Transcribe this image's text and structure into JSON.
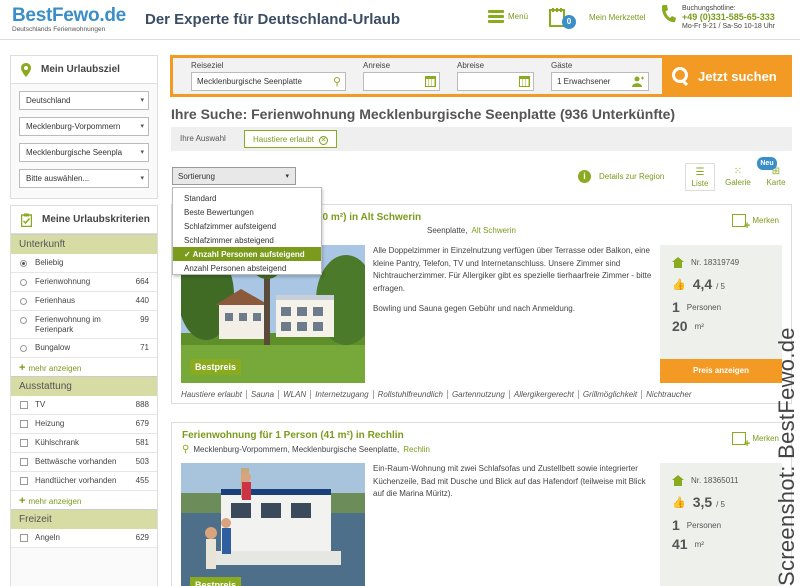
{
  "header": {
    "logo": "BestFewo.de",
    "logo_sub": "Deutschlands Ferienwohnungen",
    "tagline": "Der Experte für Deutschland-Urlaub",
    "menu_label": "Menü",
    "merkzettel_label": "Mein Merkzettel",
    "merkzettel_count": "0",
    "hotline_label": "Buchungshotline:",
    "hotline_number": "+49 (0)331-585-65-333",
    "hotline_hours": "Mo-Fr 9-21 / Sa-So 10-18 Uhr"
  },
  "sidebar": {
    "goal_title": "Mein Urlaubsziel",
    "selects": [
      "Deutschland",
      "Mecklenburg-Vorpommern",
      "Mecklenburgische Seenpla",
      "Bitte auswählen..."
    ],
    "criteria_title": "Meine Urlaubskriterien",
    "unterkunft": {
      "title": "Unterkunft",
      "items": [
        {
          "label": "Beliebig",
          "count": ""
        },
        {
          "label": "Ferienwohnung",
          "count": "664"
        },
        {
          "label": "Ferienhaus",
          "count": "440"
        },
        {
          "label": "Ferienwohnung im Ferienpark",
          "count": "99"
        },
        {
          "label": "Bungalow",
          "count": "71"
        }
      ],
      "more": "mehr anzeigen"
    },
    "ausstattung": {
      "title": "Ausstattung",
      "items": [
        {
          "label": "TV",
          "count": "888"
        },
        {
          "label": "Heizung",
          "count": "679"
        },
        {
          "label": "Kühlschrank",
          "count": "581"
        },
        {
          "label": "Bettwäsche vorhanden",
          "count": "503"
        },
        {
          "label": "Handtücher vorhanden",
          "count": "455"
        }
      ],
      "more": "mehr anzeigen"
    },
    "freizeit": {
      "title": "Freizeit",
      "items": [
        {
          "label": "Angeln",
          "count": "629"
        }
      ]
    }
  },
  "search": {
    "reiseziel_label": "Reiseziel",
    "reiseziel_value": "Mecklenburgische Seenplatte",
    "anreise_label": "Anreise",
    "abreise_label": "Abreise",
    "gaeste_label": "Gäste",
    "gaeste_value": "1 Erwachsener",
    "button": "Jetzt suchen"
  },
  "results": {
    "title": "Ihre Suche: Ferienwohnung Mecklenburgische Seenplatte (936 Unterkünfte)",
    "selection_label": "Ihre Auswahl",
    "selection_tag": "Haustiere erlaubt",
    "sort_label": "Sortierung",
    "details_region": "Details zur Region",
    "views": {
      "list": "Liste",
      "gallery": "Galerie",
      "map": "Karte",
      "new_badge": "Neu"
    },
    "sort_options": [
      "Standard",
      "Beste Bewertungen",
      "Schlafzimmer aufsteigend",
      "Schlafzimmer absteigend",
      "Anzahl Personen aufsteigend",
      "Anzahl Personen absteigend"
    ]
  },
  "listings": [
    {
      "title": "20 m²) in Alt Schwerin",
      "location": "Seenplatte,",
      "location_link": "Alt Schwerin",
      "merken": "Merken",
      "badge": "Bestpreis",
      "description": "Alle Doppelzimmer in Einzelnutzung verfügen über Terrasse oder Balkon, eine kleine Pantry, Telefon, TV und Internetanschluss. Unsere Zimmer sind Nichtraucherzimmer. Für Allergiker gibt es spezielle tierhaarfreie Zimmer - bitte erfragen.",
      "description2": "Bowling und Sauna gegen Gebühr und nach Anmeldung.",
      "nr": "Nr. 18319749",
      "rating": "4,4",
      "rating_max": "/ 5",
      "persons": "1",
      "persons_label": "Personen",
      "size": "20",
      "size_unit": "m²",
      "price_button": "Preis anzeigen",
      "features": [
        "Haustiere erlaubt",
        "Sauna",
        "WLAN",
        "Internetzugang",
        "Rollstuhlfreundlich",
        "Gartennutzung",
        "Allergikergerecht",
        "Grillmöglichkeit",
        "Nichtraucher"
      ]
    },
    {
      "title": "Ferienwohnung für 1 Person (41 m²) in Rechlin",
      "location": "Mecklenburg-Vorpommern, Mecklenburgische Seenplatte,",
      "location_link": "Rechlin",
      "merken": "Merken",
      "badge": "Bestpreis",
      "description": "Ein-Raum-Wohnung mit zwei Schlafsofas und Zustellbett sowie integrierter Küchenzeile, Bad mit Dusche und Blick auf das Hafendorf (teilweise mit Blick auf die Marina Müritz).",
      "nr": "Nr. 18365011",
      "rating": "3,5",
      "rating_max": "/ 5",
      "persons": "1",
      "persons_label": "Personen",
      "size": "41",
      "size_unit": "m²"
    }
  ],
  "watermark": "Screenshot: BestFewo.de"
}
